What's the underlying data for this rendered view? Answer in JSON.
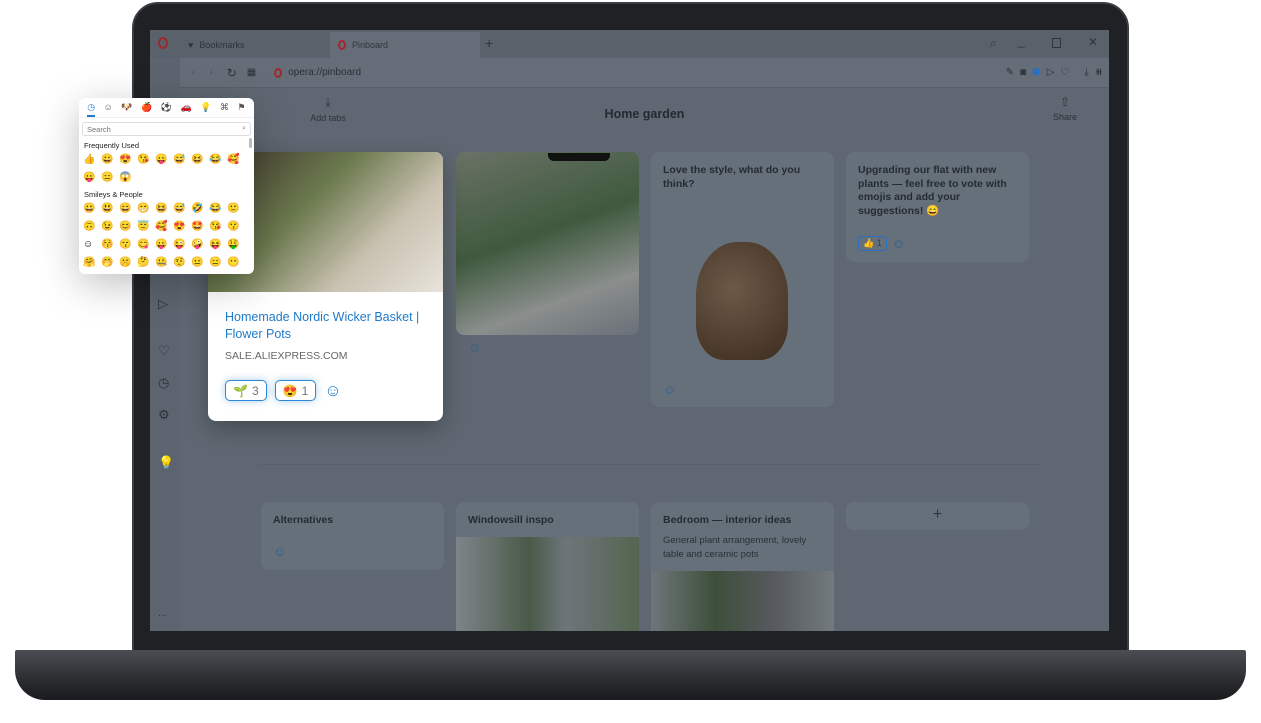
{
  "browser": {
    "tabs": [
      {
        "label": "Bookmarks",
        "icon": "heart-icon"
      },
      {
        "label": "Pinboard",
        "icon": "opera-icon"
      }
    ],
    "new_tab": "+",
    "url": "opera://pinboard",
    "window_controls": [
      "search-icon",
      "minimize-icon",
      "maximize-icon",
      "close-icon"
    ],
    "brand_color": "#a3262a",
    "accent": "#2a86d6"
  },
  "toolbar": {
    "add_tabs": "Add tabs",
    "title": "Home garden",
    "share": "Share"
  },
  "sidebar": {
    "items": [
      "send-icon",
      "heart-icon",
      "clock-icon",
      "settings-icon",
      "lightbulb-icon"
    ],
    "more": "..."
  },
  "picker": {
    "search_placeholder": "Search",
    "frequent_label": "Frequently Used",
    "smileys_label": "Smileys & People",
    "categories": [
      "clock-icon",
      "smiley-icon",
      "animal-icon",
      "food-icon",
      "activity-icon",
      "travel-icon",
      "objects-icon",
      "symbols-icon",
      "flags-icon"
    ],
    "frequent": [
      "👍",
      "😀",
      "😍",
      "😘",
      "😛",
      "😅",
      "😆",
      "😂",
      "🥰",
      "😛",
      "😑",
      "😱"
    ],
    "smileys": [
      "😀",
      "😃",
      "😄",
      "😁",
      "😆",
      "😅",
      "🤣",
      "😂",
      "🙂",
      "🙃",
      "😉",
      "😊",
      "😇",
      "🥰",
      "😍",
      "🤩",
      "😘",
      "😗",
      "☺",
      "😚",
      "😙",
      "😋",
      "😛",
      "😜",
      "🤪",
      "😝",
      "🤑",
      "🤗",
      "🤭",
      "🤫",
      "🤔",
      "🤐",
      "🤨",
      "😐",
      "😑",
      "😶"
    ]
  },
  "cards": {
    "product": {
      "title": "Homemade Nordic Wicker Basket | Flower Pots",
      "domain": "SALE.ALIEXPRESS.COM",
      "reactions": [
        {
          "emoji": "🌱",
          "count": "3"
        },
        {
          "emoji": "😍",
          "count": "1"
        }
      ]
    },
    "vase": {
      "text": "Love the style, what do you think?"
    },
    "note": {
      "text": "Upgrading our flat with new plants — feel free to vote with emojis and add your suggestions! 😄",
      "reaction": {
        "emoji": "👍",
        "count": "1"
      }
    },
    "alternatives": {
      "title": "Alternatives"
    },
    "windowsill": {
      "title": "Windowsill inspo"
    },
    "bedroom": {
      "title": "Bedroom — interior ideas",
      "text": "General plant arrangement, lovely table and ceramic pots"
    },
    "add": "+"
  }
}
